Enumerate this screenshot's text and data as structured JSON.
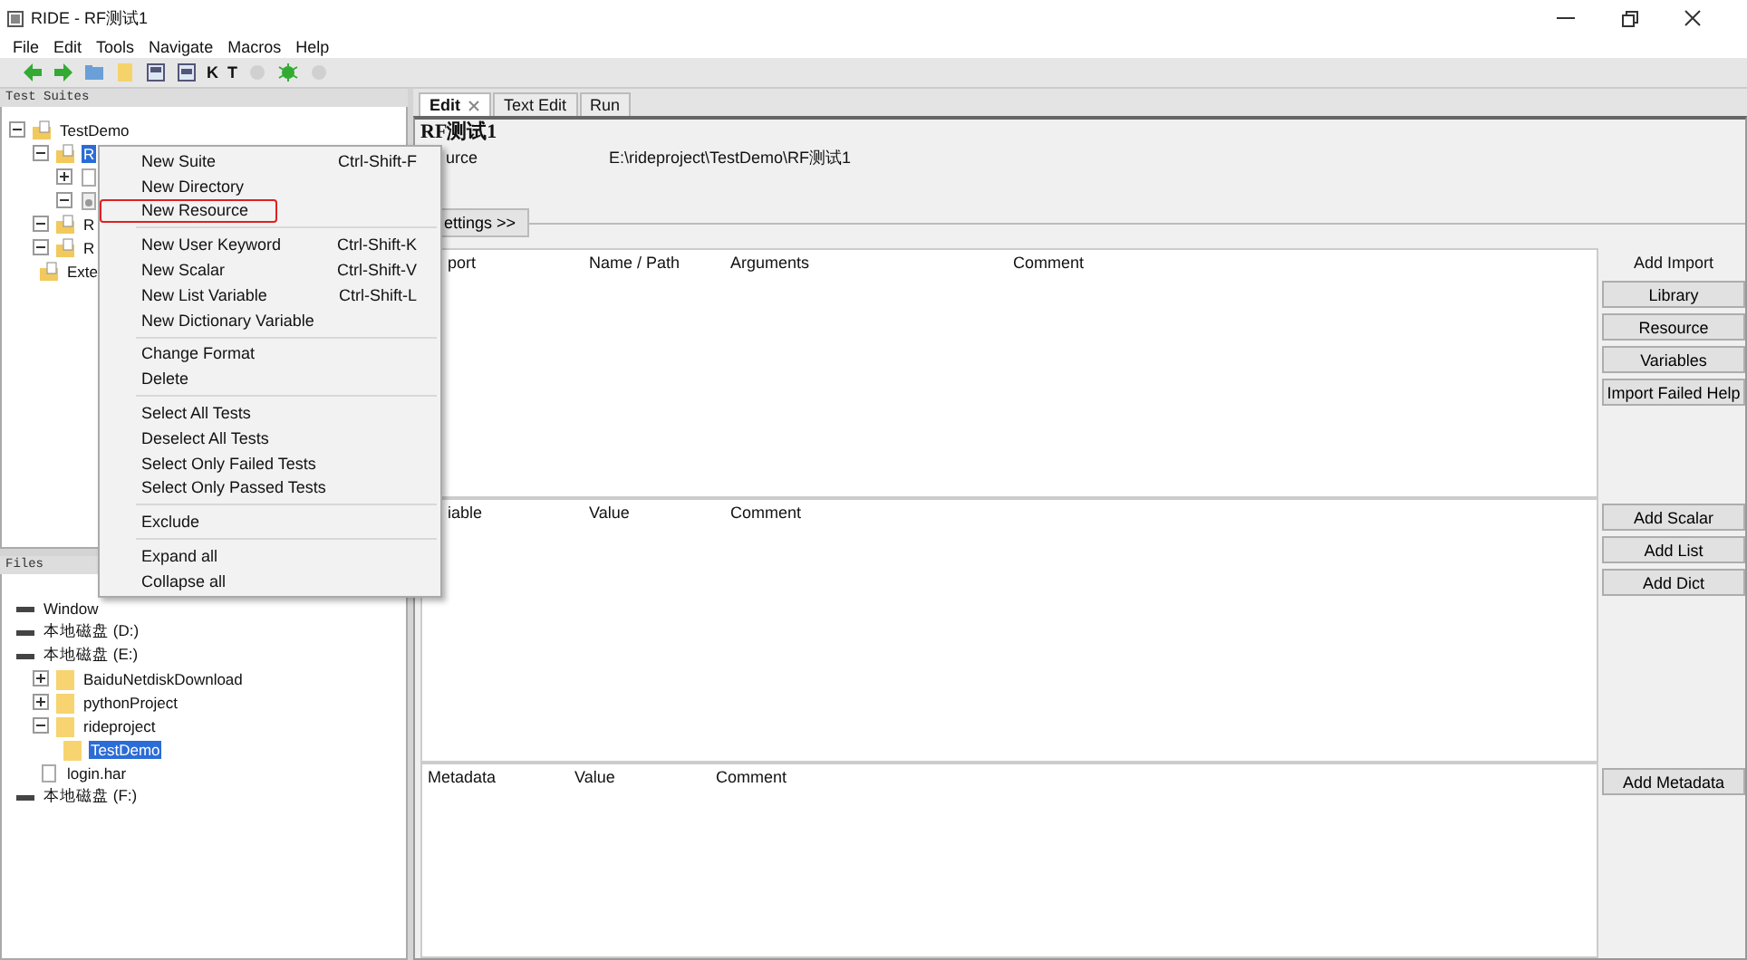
{
  "window": {
    "title": "RIDE - RF测试1"
  },
  "menubar": [
    "File",
    "Edit",
    "Tools",
    "Navigate",
    "Macros",
    "Help"
  ],
  "toolbar": [
    {
      "kind": "back",
      "disabled": false
    },
    {
      "kind": "forward",
      "disabled": false
    },
    {
      "kind": "open",
      "disabled": false
    },
    {
      "kind": "folder",
      "disabled": false
    },
    {
      "kind": "save",
      "disabled": false
    },
    {
      "kind": "saveall",
      "disabled": false
    },
    {
      "kind": "letter",
      "label": "K",
      "disabled": false
    },
    {
      "kind": "letter",
      "label": "T",
      "disabled": false
    },
    {
      "kind": "circle",
      "disabled": true
    },
    {
      "kind": "bug",
      "disabled": false
    },
    {
      "kind": "circle",
      "disabled": true
    }
  ],
  "test_suites": {
    "title": "Test Suites",
    "tree": [
      {
        "label": "TestDemo",
        "kind": "suite",
        "expanded": true,
        "selected": false,
        "children": [
          {
            "label": "R",
            "kind": "suite",
            "expanded": true,
            "selected": true,
            "children": [
              {
                "kind": "file",
                "expanded": false
              },
              {
                "kind": "resource",
                "expanded": true
              }
            ]
          },
          {
            "label": "R",
            "kind": "suite",
            "expanded": true,
            "selected": false
          },
          {
            "label": "R",
            "kind": "suite",
            "expanded": true,
            "selected": false
          },
          {
            "label": "Exte",
            "kind": "suite",
            "selected": false
          }
        ]
      }
    ]
  },
  "files": {
    "title": "Files",
    "tree": [
      {
        "label": "Window",
        "kind": "drive"
      },
      {
        "label": "本地磁盘 (D:)",
        "kind": "drive"
      },
      {
        "label": "本地磁盘 (E:)",
        "kind": "drive",
        "children": [
          {
            "label": "BaiduNetdiskDownload",
            "kind": "folder",
            "expanded": false,
            "selected": false
          },
          {
            "label": "pythonProject",
            "kind": "folder",
            "expanded": false,
            "selected": false
          },
          {
            "label": "rideproject",
            "kind": "folder",
            "expanded": true,
            "selected": false,
            "children": [
              {
                "label": "TestDemo",
                "kind": "folder",
                "selected": true
              }
            ]
          },
          {
            "label": "login.har",
            "kind": "file",
            "selected": false
          }
        ]
      },
      {
        "label": "本地磁盘 (F:)",
        "kind": "drive"
      }
    ]
  },
  "tabs": [
    {
      "label": "Edit",
      "selected": true,
      "closable": true
    },
    {
      "label": "Text Edit",
      "selected": false,
      "closable": false
    },
    {
      "label": "Run",
      "selected": false,
      "closable": false
    }
  ],
  "editor": {
    "heading": "RF测试1",
    "source_label": "urce",
    "source": "E:\\rideproject\\TestDemo\\RF测试1",
    "settings_button": "ettings >>",
    "sections": [
      {
        "columns": [
          "port",
          "Name / Path",
          "Arguments",
          "Comment"
        ],
        "side_title": "Add Import",
        "buttons": [
          "Library",
          "Resource",
          "Variables",
          "Import Failed Help"
        ]
      },
      {
        "columns": [
          "iable",
          "Value",
          "Comment"
        ],
        "buttons": [
          "Add Scalar",
          "Add List",
          "Add Dict"
        ]
      },
      {
        "columns": [
          "Metadata",
          "Value",
          "Comment"
        ],
        "buttons": [
          "Add Metadata"
        ]
      }
    ]
  },
  "context_menu": [
    {
      "kind": "item",
      "label": "New Suite",
      "shortcut": "Ctrl-Shift-F",
      "marked": false
    },
    {
      "kind": "item",
      "label": "New Directory",
      "marked": false
    },
    {
      "kind": "item",
      "label": "New Resource",
      "marked": true
    },
    {
      "kind": "separator"
    },
    {
      "kind": "item",
      "label": "New User Keyword",
      "shortcut": "Ctrl-Shift-K",
      "marked": false
    },
    {
      "kind": "item",
      "label": "New Scalar",
      "shortcut": "Ctrl-Shift-V",
      "marked": false
    },
    {
      "kind": "item",
      "label": "New List Variable",
      "shortcut": "Ctrl-Shift-L",
      "marked": false
    },
    {
      "kind": "item",
      "label": "New Dictionary Variable",
      "marked": false
    },
    {
      "kind": "separator"
    },
    {
      "kind": "item",
      "label": "Change Format",
      "marked": false
    },
    {
      "kind": "item",
      "label": "Delete",
      "marked": false
    },
    {
      "kind": "separator"
    },
    {
      "kind": "item",
      "label": "Select All Tests",
      "marked": false
    },
    {
      "kind": "item",
      "label": "Deselect All Tests",
      "marked": false
    },
    {
      "kind": "item",
      "label": "Select Only Failed Tests",
      "marked": false
    },
    {
      "kind": "item",
      "label": "Select Only Passed Tests",
      "marked": false
    },
    {
      "kind": "separator"
    },
    {
      "kind": "item",
      "label": "Exclude",
      "marked": false
    },
    {
      "kind": "separator"
    },
    {
      "kind": "item",
      "label": "Expand all",
      "marked": false
    },
    {
      "kind": "item",
      "label": "Collapse all",
      "marked": false
    }
  ]
}
